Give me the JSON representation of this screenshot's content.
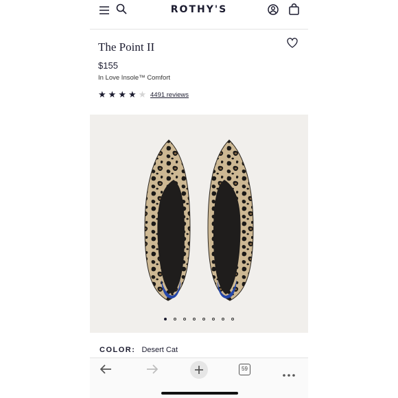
{
  "header": {
    "brand": "ROTHY'S"
  },
  "product": {
    "title": "The Point II",
    "price": "$155",
    "feature": "In Love Insole™ Comfort",
    "rating": 4,
    "rating_max": 5,
    "reviews_text": "4491 reviews",
    "color_label": "COLOR:",
    "color_value": "Desert Cat"
  },
  "gallery": {
    "image_count": 8,
    "active_index": 0
  },
  "browser": {
    "tab_count": "59"
  },
  "colors": {
    "brand_navy": "#1b1b2f",
    "gallery_bg": "#f1efec"
  }
}
